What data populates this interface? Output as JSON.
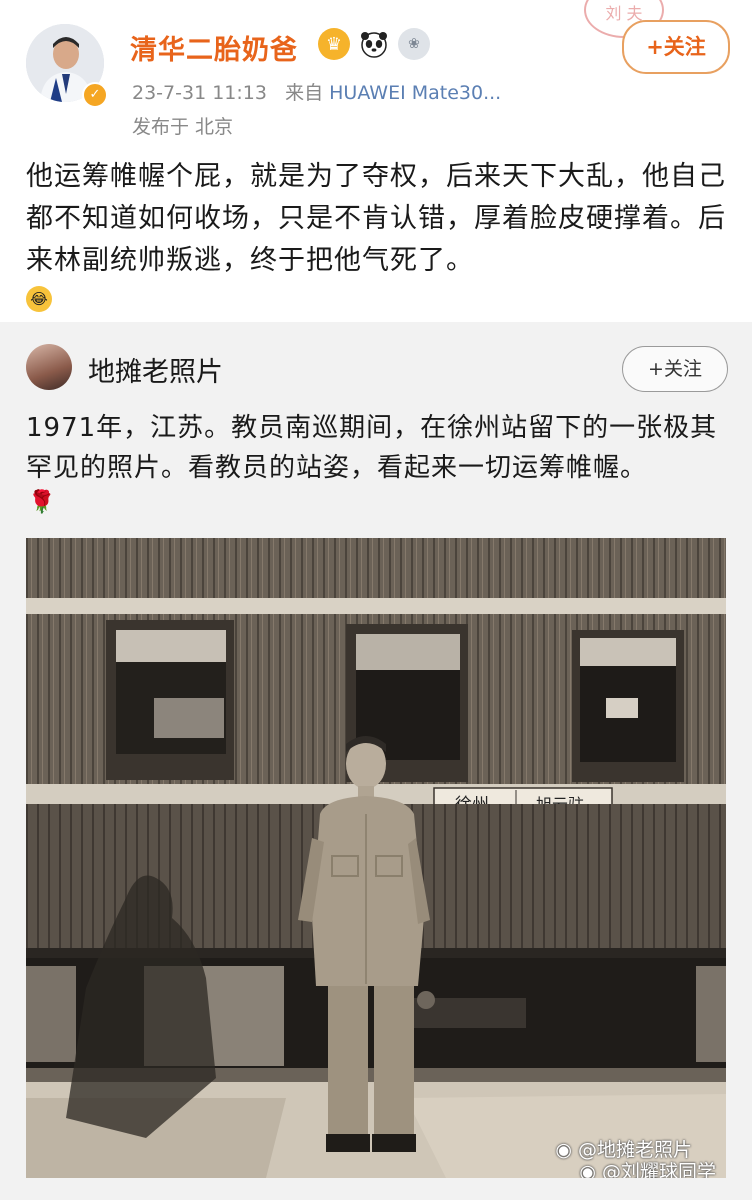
{
  "post": {
    "author": "清华二胎奶爸",
    "badges": [
      "crown-badge",
      "panda-badge",
      "medal-badge"
    ],
    "time": "23-7-31 11:13",
    "source_prefix": "来自",
    "device": "HUAWEI Mate30...",
    "location": "发布于 北京",
    "follow_label": "+关注",
    "text": "他运筹帷幄个屁，就是为了夺权，后来天下大乱，他自己都不知道如何收场，只是不肯认错，厚着脸皮硬撑着。后来林副统帅叛逃，终于把他气死了。",
    "emoji": "laughing-crying-emoji"
  },
  "shared": {
    "author": "地摊老照片",
    "follow_label": "+关注",
    "text": "1971年，江苏。教员南巡期间，在徐州站留下的一张极其罕见的照片。看教员的站姿，看起来一切运筹帷幄。",
    "emoji": "rose-emoji",
    "sign": {
      "station": "徐州",
      "destination": "旭云驻"
    },
    "watermark1": "@地摊老照片",
    "watermark2": "@刘耀球同学"
  },
  "colors": {
    "accent": "#e8641b",
    "link": "#5b7fb3",
    "muted": "#888888"
  }
}
